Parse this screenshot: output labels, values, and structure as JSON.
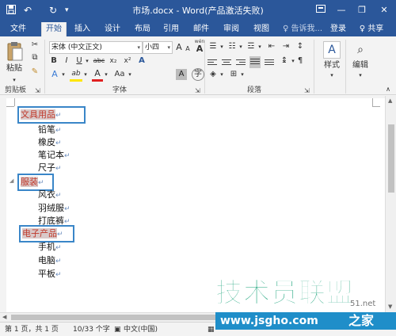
{
  "window": {
    "title": "市场.docx - Word(产品激活失败)",
    "minimize": "—",
    "restore": "❐",
    "close": "✕"
  },
  "quick_access": {
    "save_icon": "save-icon",
    "undo": "↶",
    "redo": "↻",
    "customize": "▾"
  },
  "tabs": [
    "文件",
    "开始",
    "插入",
    "设计",
    "布局",
    "引用",
    "邮件",
    "审阅",
    "视图"
  ],
  "tell_me": "♀ 告诉我...",
  "sign_in": "登录",
  "share": "♀ 共享",
  "ribbon": {
    "clipboard": {
      "paste": "粘贴",
      "cut": "✂",
      "copy": "⧉",
      "format_painter": "✎",
      "label": "剪贴板",
      "launcher": "⇲"
    },
    "font": {
      "font_name": "宋体 (中文正文)",
      "font_size": "小四",
      "grow": "A",
      "shrink": "A",
      "case": "Aa",
      "clear": "A",
      "wen": "wén",
      "a_box": "A",
      "bold": "B",
      "italic": "I",
      "underline": "U",
      "strike": "abc",
      "subscript": "x₂",
      "superscript": "x²",
      "text_effect": "A",
      "highlight": "ab",
      "font_color": "A",
      "char_shading": "A",
      "enclose": "字",
      "label": "字体",
      "launcher": "⇲"
    },
    "paragraph": {
      "bullets": "☰",
      "numbering": "☷",
      "multilevel": "☲",
      "decrease_indent": "⇤",
      "increase_indent": "⇥",
      "sort": "↕",
      "show_marks": "¶",
      "line_spacing": "↨",
      "shading": "◈",
      "borders": "⊞",
      "label": "段落",
      "launcher": "⇲"
    },
    "styles": {
      "label": "样式"
    },
    "editing": {
      "label": "编辑"
    },
    "collapse": "∧"
  },
  "document": {
    "lines": [
      {
        "text": "文具用品",
        "mark": "↵",
        "level": 1
      },
      {
        "text": "铅笔",
        "mark": "↵",
        "level": 2
      },
      {
        "text": "橡皮",
        "mark": "↵",
        "level": 2
      },
      {
        "text": "笔记本",
        "mark": "↵",
        "level": 2
      },
      {
        "text": "尺子",
        "mark": "↵",
        "level": 2
      },
      {
        "text": "服装",
        "mark": "↵",
        "level": 1
      },
      {
        "text": "风衣",
        "mark": "↵",
        "level": 2
      },
      {
        "text": "羽绒服",
        "mark": "↵",
        "level": 2
      },
      {
        "text": "打底裤",
        "mark": "↵",
        "level": 2
      },
      {
        "text": "电子产品",
        "mark": "↵",
        "level": 1
      },
      {
        "text": "手机",
        "mark": "↵",
        "level": 2
      },
      {
        "text": "电脑",
        "mark": "↵",
        "level": 2
      },
      {
        "text": "平板",
        "mark": "↵",
        "level": 2
      }
    ],
    "highlight_color": "#3a86c8",
    "heading_color": "#c0392b"
  },
  "scroll": {
    "up": "▲",
    "down": "▼",
    "left": "◀",
    "right": "▶"
  },
  "status": {
    "page": "第 1 页，共 1 页",
    "words": "10/33 个字",
    "language": "中文(中国)"
  },
  "watermark": {
    "brand": "技术员联盟",
    "url": "www.jsgho.com",
    "suffix": "之家",
    "num": "51.net"
  },
  "colors": {
    "title_bar": "#2b579a",
    "ribbon_bg": "#f3f3f3"
  }
}
